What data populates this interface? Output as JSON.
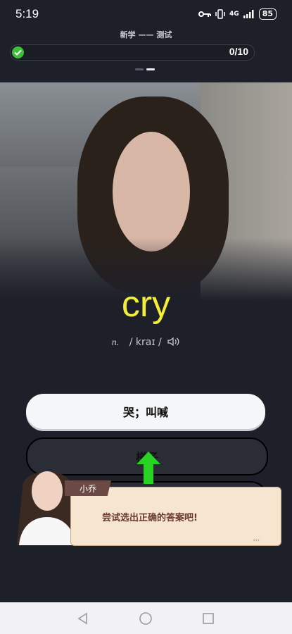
{
  "status": {
    "time": "5:19",
    "network": "4G",
    "battery": "85"
  },
  "header": {
    "title": "新学 —— 测试"
  },
  "progress": {
    "text": "0/10",
    "value": 0
  },
  "word": {
    "text": "cry",
    "pos": "n.",
    "phonetic": "/ kraɪ /"
  },
  "answers": [
    "哭；叫喊",
    "梯子"
  ],
  "dialog": {
    "speaker": "小乔",
    "message": "尝试选出正确的答案吧!"
  },
  "colors": {
    "background": "#1d2029",
    "word": "#f3ee37",
    "progress_check": "#3fbf3a",
    "dialog_bg": "#f6e5cf",
    "name_tag": "#6b4a45",
    "arrow": "#29d324"
  },
  "icons": [
    "key-icon",
    "vibrate-icon",
    "signal-icon",
    "battery-icon",
    "check-icon",
    "speaker-icon",
    "back-icon",
    "home-icon",
    "recents-icon"
  ]
}
